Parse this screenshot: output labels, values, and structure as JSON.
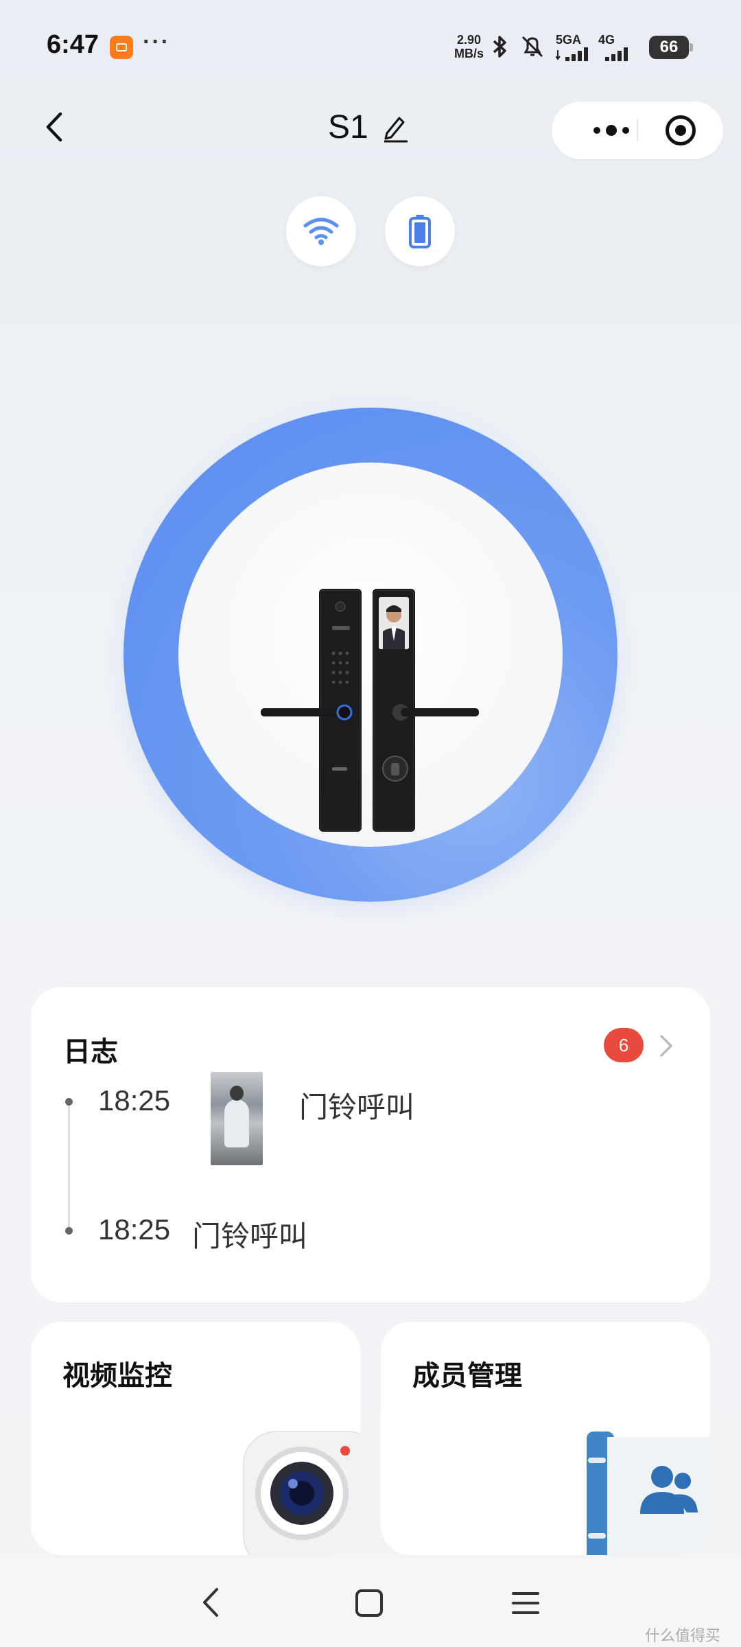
{
  "status_bar": {
    "time": "6:47",
    "more": "···",
    "speed_value": "2.90",
    "speed_unit": "MB/s",
    "net1": "5GA",
    "net2": "4G",
    "battery": "66"
  },
  "header": {
    "title": "S1"
  },
  "log": {
    "title": "日志",
    "badge": "6",
    "entries": [
      {
        "time": "18:25",
        "text": "门铃呼叫"
      },
      {
        "time": "18:25",
        "text": "门铃呼叫"
      }
    ]
  },
  "tiles": {
    "video": "视频监控",
    "members": "成员管理"
  },
  "watermark": "什么值得买",
  "colors": {
    "accent": "#5a8cf0",
    "badge": "#e84a3d"
  }
}
